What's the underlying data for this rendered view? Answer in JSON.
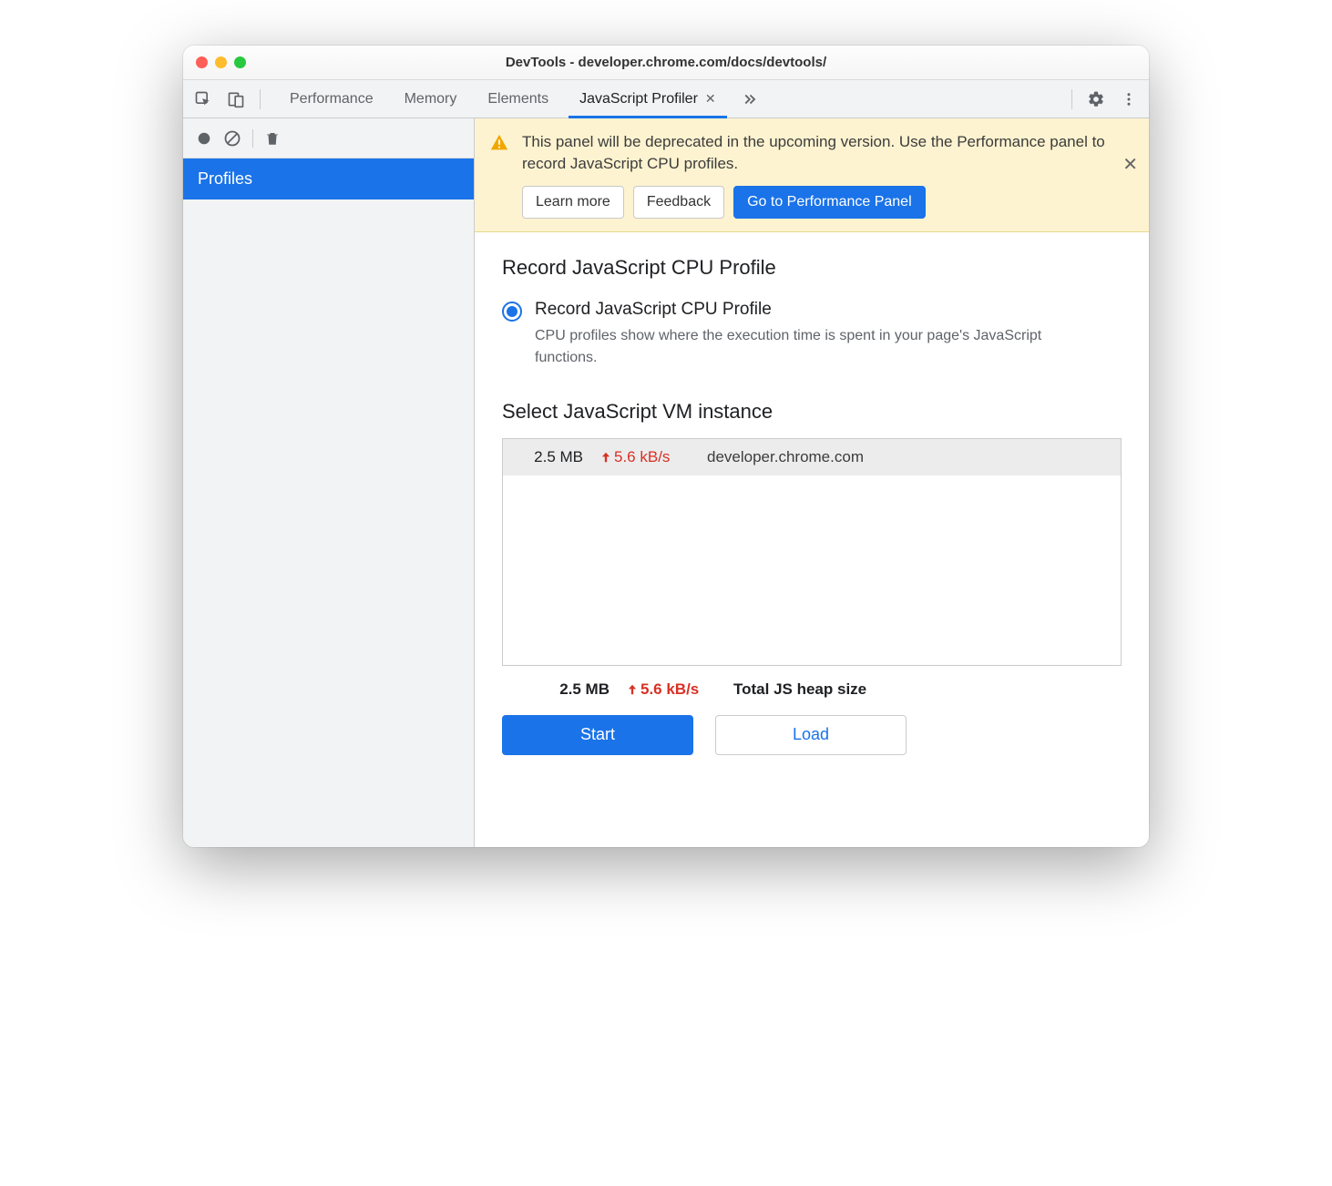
{
  "window": {
    "title": "DevTools - developer.chrome.com/docs/devtools/"
  },
  "tabs": {
    "items": [
      "Performance",
      "Memory",
      "Elements",
      "JavaScript Profiler"
    ],
    "active_index": 3
  },
  "sidebar": {
    "items": [
      {
        "label": "Profiles"
      }
    ]
  },
  "banner": {
    "text": "This panel will be deprecated in the upcoming version. Use the Performance panel to record JavaScript CPU profiles.",
    "learn_more": "Learn more",
    "feedback": "Feedback",
    "go_to_perf": "Go to Performance Panel"
  },
  "panel": {
    "heading": "Record JavaScript CPU Profile",
    "option_label": "Record JavaScript CPU Profile",
    "option_desc": "CPU profiles show where the execution time is spent in your page's JavaScript functions.",
    "vm_heading": "Select JavaScript VM instance",
    "vm_rows": [
      {
        "size": "2.5 MB",
        "rate": "5.6 kB/s",
        "host": "developer.chrome.com"
      }
    ],
    "total": {
      "size": "2.5 MB",
      "rate": "5.6 kB/s",
      "label": "Total JS heap size"
    },
    "start": "Start",
    "load": "Load"
  }
}
